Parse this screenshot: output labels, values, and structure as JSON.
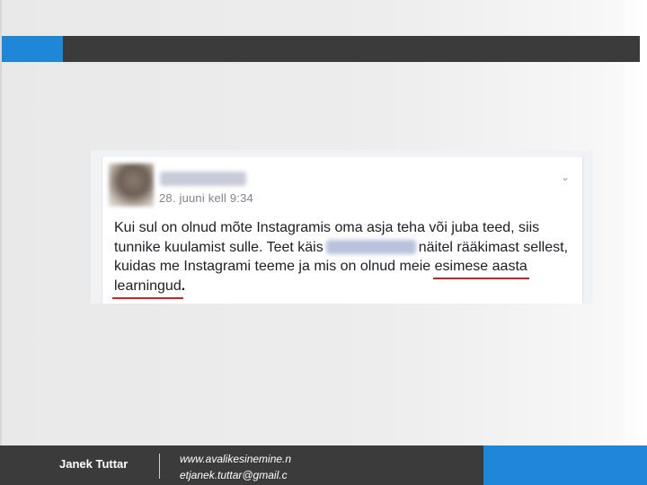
{
  "post": {
    "timestamp": "28. juuni kell 9:34",
    "chevron_icon": "chevron-down-icon",
    "text": {
      "line1": "Kui sul on olnud mõte Instagramis oma asja teha või juba teed, siis",
      "line2_a": "tunnike kuulamist sulle. Teet käis",
      "line2_b": "näitel rääkimast sellest,",
      "line3_a": "kuidas me Instagrami teeme ja mis on olnud meie",
      "line3_b": "esimese aasta",
      "line4_a": "learningud",
      "line4_b": "."
    },
    "underline_color": "#d42020"
  },
  "footer": {
    "author": "Janek Tuttar",
    "website": "www.avalikesinemine.n",
    "email": "etjanek.tuttar@gmail.c"
  },
  "colors": {
    "accent_blue": "#1f87d8",
    "bar_dark": "#3b3b3b"
  }
}
